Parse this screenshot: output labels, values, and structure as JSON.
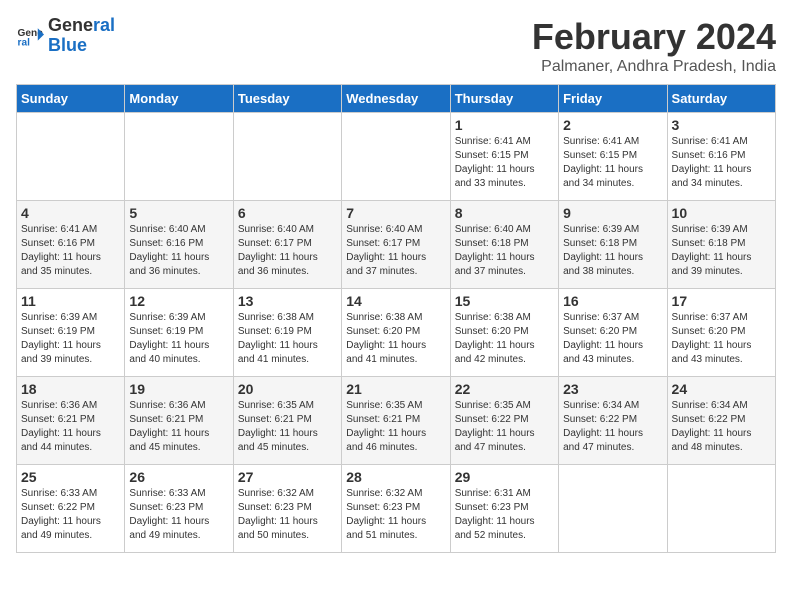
{
  "logo": {
    "line1": "General",
    "line2": "Blue"
  },
  "title": "February 2024",
  "location": "Palmaner, Andhra Pradesh, India",
  "days_of_week": [
    "Sunday",
    "Monday",
    "Tuesday",
    "Wednesday",
    "Thursday",
    "Friday",
    "Saturday"
  ],
  "weeks": [
    [
      {
        "num": "",
        "info": ""
      },
      {
        "num": "",
        "info": ""
      },
      {
        "num": "",
        "info": ""
      },
      {
        "num": "",
        "info": ""
      },
      {
        "num": "1",
        "info": "Sunrise: 6:41 AM\nSunset: 6:15 PM\nDaylight: 11 hours\nand 33 minutes."
      },
      {
        "num": "2",
        "info": "Sunrise: 6:41 AM\nSunset: 6:15 PM\nDaylight: 11 hours\nand 34 minutes."
      },
      {
        "num": "3",
        "info": "Sunrise: 6:41 AM\nSunset: 6:16 PM\nDaylight: 11 hours\nand 34 minutes."
      }
    ],
    [
      {
        "num": "4",
        "info": "Sunrise: 6:41 AM\nSunset: 6:16 PM\nDaylight: 11 hours\nand 35 minutes."
      },
      {
        "num": "5",
        "info": "Sunrise: 6:40 AM\nSunset: 6:16 PM\nDaylight: 11 hours\nand 36 minutes."
      },
      {
        "num": "6",
        "info": "Sunrise: 6:40 AM\nSunset: 6:17 PM\nDaylight: 11 hours\nand 36 minutes."
      },
      {
        "num": "7",
        "info": "Sunrise: 6:40 AM\nSunset: 6:17 PM\nDaylight: 11 hours\nand 37 minutes."
      },
      {
        "num": "8",
        "info": "Sunrise: 6:40 AM\nSunset: 6:18 PM\nDaylight: 11 hours\nand 37 minutes."
      },
      {
        "num": "9",
        "info": "Sunrise: 6:39 AM\nSunset: 6:18 PM\nDaylight: 11 hours\nand 38 minutes."
      },
      {
        "num": "10",
        "info": "Sunrise: 6:39 AM\nSunset: 6:18 PM\nDaylight: 11 hours\nand 39 minutes."
      }
    ],
    [
      {
        "num": "11",
        "info": "Sunrise: 6:39 AM\nSunset: 6:19 PM\nDaylight: 11 hours\nand 39 minutes."
      },
      {
        "num": "12",
        "info": "Sunrise: 6:39 AM\nSunset: 6:19 PM\nDaylight: 11 hours\nand 40 minutes."
      },
      {
        "num": "13",
        "info": "Sunrise: 6:38 AM\nSunset: 6:19 PM\nDaylight: 11 hours\nand 41 minutes."
      },
      {
        "num": "14",
        "info": "Sunrise: 6:38 AM\nSunset: 6:20 PM\nDaylight: 11 hours\nand 41 minutes."
      },
      {
        "num": "15",
        "info": "Sunrise: 6:38 AM\nSunset: 6:20 PM\nDaylight: 11 hours\nand 42 minutes."
      },
      {
        "num": "16",
        "info": "Sunrise: 6:37 AM\nSunset: 6:20 PM\nDaylight: 11 hours\nand 43 minutes."
      },
      {
        "num": "17",
        "info": "Sunrise: 6:37 AM\nSunset: 6:20 PM\nDaylight: 11 hours\nand 43 minutes."
      }
    ],
    [
      {
        "num": "18",
        "info": "Sunrise: 6:36 AM\nSunset: 6:21 PM\nDaylight: 11 hours\nand 44 minutes."
      },
      {
        "num": "19",
        "info": "Sunrise: 6:36 AM\nSunset: 6:21 PM\nDaylight: 11 hours\nand 45 minutes."
      },
      {
        "num": "20",
        "info": "Sunrise: 6:35 AM\nSunset: 6:21 PM\nDaylight: 11 hours\nand 45 minutes."
      },
      {
        "num": "21",
        "info": "Sunrise: 6:35 AM\nSunset: 6:21 PM\nDaylight: 11 hours\nand 46 minutes."
      },
      {
        "num": "22",
        "info": "Sunrise: 6:35 AM\nSunset: 6:22 PM\nDaylight: 11 hours\nand 47 minutes."
      },
      {
        "num": "23",
        "info": "Sunrise: 6:34 AM\nSunset: 6:22 PM\nDaylight: 11 hours\nand 47 minutes."
      },
      {
        "num": "24",
        "info": "Sunrise: 6:34 AM\nSunset: 6:22 PM\nDaylight: 11 hours\nand 48 minutes."
      }
    ],
    [
      {
        "num": "25",
        "info": "Sunrise: 6:33 AM\nSunset: 6:22 PM\nDaylight: 11 hours\nand 49 minutes."
      },
      {
        "num": "26",
        "info": "Sunrise: 6:33 AM\nSunset: 6:23 PM\nDaylight: 11 hours\nand 49 minutes."
      },
      {
        "num": "27",
        "info": "Sunrise: 6:32 AM\nSunset: 6:23 PM\nDaylight: 11 hours\nand 50 minutes."
      },
      {
        "num": "28",
        "info": "Sunrise: 6:32 AM\nSunset: 6:23 PM\nDaylight: 11 hours\nand 51 minutes."
      },
      {
        "num": "29",
        "info": "Sunrise: 6:31 AM\nSunset: 6:23 PM\nDaylight: 11 hours\nand 52 minutes."
      },
      {
        "num": "",
        "info": ""
      },
      {
        "num": "",
        "info": ""
      }
    ]
  ]
}
